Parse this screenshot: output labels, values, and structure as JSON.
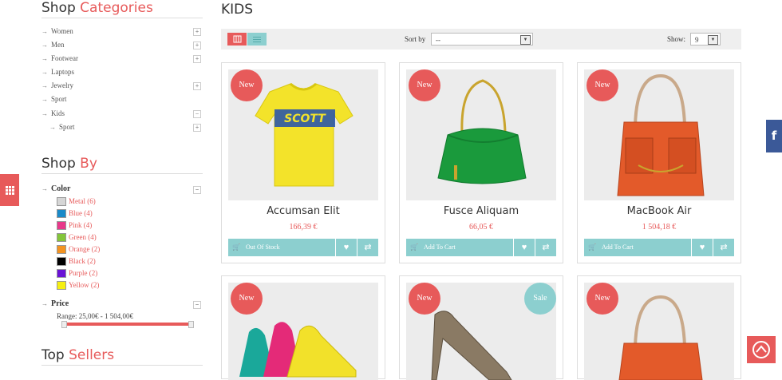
{
  "sidebar": {
    "categories_title": {
      "pre": "Shop ",
      "accent": "Categories"
    },
    "categories": [
      {
        "label": "Women",
        "toggle": "+"
      },
      {
        "label": "Men",
        "toggle": "+"
      },
      {
        "label": "Footwear",
        "toggle": "+"
      },
      {
        "label": "Laptops",
        "toggle": ""
      },
      {
        "label": "Jewelry",
        "toggle": "+"
      },
      {
        "label": "Sport",
        "toggle": ""
      },
      {
        "label": "Kids",
        "toggle": "−"
      },
      {
        "label": "Sport",
        "toggle": "+",
        "sub": true
      }
    ],
    "shopby_title": {
      "pre": "Shop ",
      "accent": "By"
    },
    "color_title": "Color",
    "color_toggle": "−",
    "colors": [
      {
        "label": "Metal (6)",
        "hex": "#d6d6d6"
      },
      {
        "label": "Blue (4)",
        "hex": "#1a8ac9"
      },
      {
        "label": "Pink (4)",
        "hex": "#e8388a"
      },
      {
        "label": "Green (4)",
        "hex": "#83c53a"
      },
      {
        "label": "Orange (2)",
        "hex": "#f39322"
      },
      {
        "label": "Black (2)",
        "hex": "#000000"
      },
      {
        "label": "Purple (2)",
        "hex": "#6a12d6"
      },
      {
        "label": "Yellow (2)",
        "hex": "#f5ef12"
      }
    ],
    "price_title": "Price",
    "price_toggle": "−",
    "price_range": "Range: 25,00€ - 1 504,00€",
    "topsellers_title": {
      "pre": "Top ",
      "accent": "Sellers"
    }
  },
  "main": {
    "title": "KIDS",
    "sort_label": "Sort by",
    "sort_value": "--",
    "show_label": "Show:",
    "show_value": "9",
    "products": [
      {
        "name": "Accumsan Elit",
        "price": "166,39 €",
        "badge": "New",
        "cta": "Out Of Stock"
      },
      {
        "name": "Fusce Aliquam",
        "price": "66,05 €",
        "badge": "New",
        "cta": "Add To Cart"
      },
      {
        "name": "MacBook Air",
        "price": "1 504,18 €",
        "badge": "New",
        "cta": "Add To Cart"
      },
      {
        "badge": "New"
      },
      {
        "badge": "New",
        "sale": "Sale"
      },
      {
        "badge": "New"
      }
    ]
  },
  "social": {
    "facebook": "f"
  },
  "colors": {
    "accent": "#e75a5a",
    "teal": "#8ccfcf",
    "facebook": "#3b5998"
  }
}
